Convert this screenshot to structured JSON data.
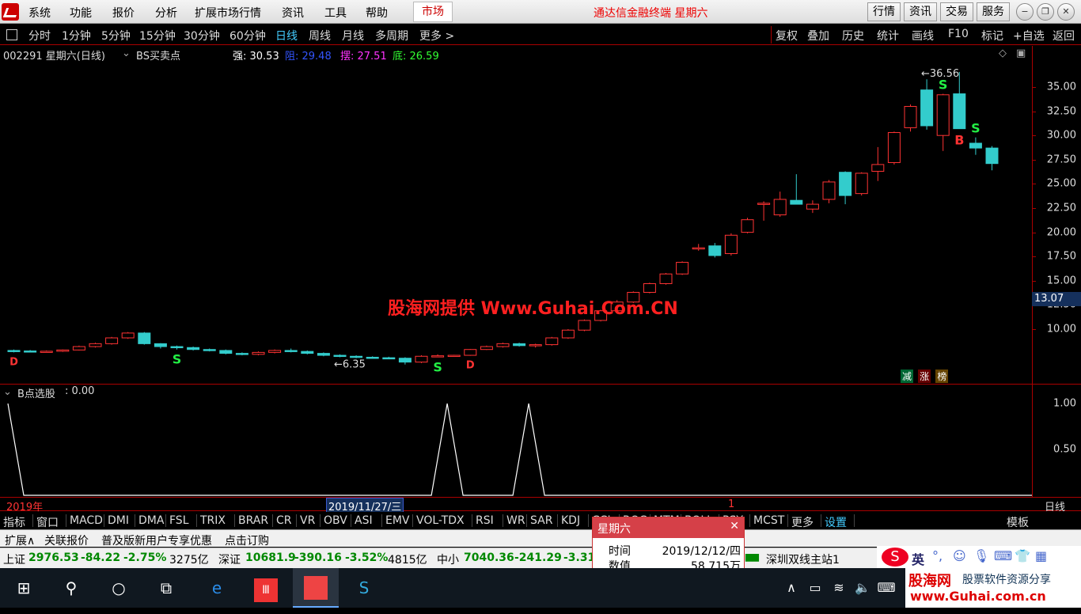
{
  "menu": {
    "items": [
      "系统",
      "功能",
      "报价",
      "分析",
      "扩展市场行情",
      "资讯",
      "工具",
      "帮助"
    ],
    "market_tab": "市场",
    "title": "通达信金融终端 星期六",
    "right_buttons": [
      "行情",
      "资讯",
      "交易",
      "服务"
    ]
  },
  "period_bar": {
    "items": [
      "分时",
      "1分钟",
      "5分钟",
      "15分钟",
      "30分钟",
      "60分钟",
      "日线",
      "周线",
      "月线",
      "多周期",
      "更多 >"
    ],
    "active": "日线",
    "tools": [
      "复权",
      "叠加",
      "历史",
      "统计",
      "画线",
      "F10",
      "标记",
      "+自选",
      "返回"
    ]
  },
  "info": {
    "code_name": "002291 星期六(日线)",
    "indicator": "BS买卖点",
    "strong_label": "强: 30.53",
    "resist_label": "阻: 29.48",
    "swing_label": "摆: 27.51",
    "bottom_label": "底: 26.59"
  },
  "colors": {
    "up": "#ff3333",
    "down": "#33cccc",
    "strong": "#ffffff",
    "resist": "#3355ff",
    "swing": "#ff33ff",
    "bottom": "#33ff33"
  },
  "yaxis": {
    "labels": [
      "35.00",
      "32.50",
      "30.00",
      "27.50",
      "25.00",
      "22.50",
      "20.00",
      "17.50",
      "15.00",
      "12.50",
      "10.00"
    ],
    "current": "13.07"
  },
  "annotations": {
    "high": "36.56",
    "low": "6.35",
    "watermark": "股海网提供 Www.Guhai.Com.CN",
    "badges": [
      "减",
      "涨",
      "榜"
    ]
  },
  "signals": {
    "B": "B",
    "S": "S",
    "D": "D"
  },
  "indicator": {
    "name": "B点选股",
    "value": ": 0.00",
    "axis": [
      "1.00",
      "0.50"
    ]
  },
  "datebar": {
    "year": "2019年",
    "cursor_date": "2019/11/27/三",
    "tick": "1",
    "period": "日线"
  },
  "indicator_tabs": {
    "items": [
      "指标",
      "窗口",
      "MACD",
      "DMI",
      "DMA",
      "FSL",
      "TRIX",
      "BRAR",
      "CR",
      "VR",
      "OBV",
      "ASI",
      "EMV",
      "VOL-TDX",
      "RSI",
      "WR",
      "SAR",
      "KDJ",
      "CCI",
      "ROC",
      "MTM",
      "BOLL",
      "PSY",
      "MCST",
      "更多",
      "设置"
    ],
    "template": "模板"
  },
  "ext_bar": {
    "items": [
      "扩展∧",
      "关联报价",
      "普及版新用户专享优惠",
      "点击订购"
    ]
  },
  "ticker": {
    "sh_label": "上证",
    "sh_val": "2976.53",
    "sh_chg": "-84.22",
    "sh_pct": "-2.75%",
    "sh_amt": "3275亿",
    "sz_label": "深证",
    "sz_val": "10681.9",
    "sz_chg": "-390.16",
    "sz_pct": "-3.52%",
    "sz_amt": "4815亿",
    "zx_label": "中小",
    "zx_val": "7040.36",
    "zx_chg": "-241.29",
    "zx_pct": "-3.31°",
    "server": "深圳双线主站1"
  },
  "popup": {
    "title": "星期六",
    "time_label": "时间",
    "time_val": "2019/12/12/四",
    "value_label": "数值",
    "value_val": "58.715万"
  },
  "ime": {
    "lang": "英"
  },
  "banner": {
    "name": "股海网",
    "slogan": "股票软件资源分享",
    "url": "www.Guhai.com.cn"
  },
  "chart_data": {
    "type": "candlestick",
    "ylim": [
      6.0,
      37.0
    ],
    "ohlc": [
      [
        7.8,
        7.9,
        7.6,
        7.75
      ],
      [
        7.75,
        7.85,
        7.65,
        7.7
      ],
      [
        7.7,
        7.8,
        7.6,
        7.72
      ],
      [
        7.72,
        7.9,
        7.65,
        7.85
      ],
      [
        7.85,
        8.3,
        7.8,
        8.2
      ],
      [
        8.2,
        8.6,
        8.1,
        8.5
      ],
      [
        8.5,
        9.2,
        8.4,
        9.1
      ],
      [
        9.1,
        9.7,
        9.0,
        9.6
      ],
      [
        9.6,
        9.7,
        8.4,
        8.5
      ],
      [
        8.5,
        8.55,
        8.0,
        8.2
      ],
      [
        8.2,
        8.3,
        7.9,
        8.1
      ],
      [
        8.1,
        8.2,
        7.8,
        7.9
      ],
      [
        7.9,
        8.0,
        7.7,
        7.8
      ],
      [
        7.8,
        7.9,
        7.4,
        7.5
      ],
      [
        7.5,
        7.6,
        7.3,
        7.4
      ],
      [
        7.4,
        7.7,
        7.3,
        7.6
      ],
      [
        7.6,
        7.9,
        7.5,
        7.8
      ],
      [
        7.8,
        8.0,
        7.6,
        7.7
      ],
      [
        7.7,
        7.8,
        7.4,
        7.5
      ],
      [
        7.5,
        7.6,
        7.2,
        7.3
      ],
      [
        7.3,
        7.4,
        7.1,
        7.2
      ],
      [
        7.2,
        7.3,
        7.0,
        7.1
      ],
      [
        7.1,
        7.2,
        6.95,
        7.05
      ],
      [
        7.05,
        7.15,
        6.9,
        7.0
      ],
      [
        7.0,
        7.1,
        6.35,
        6.6
      ],
      [
        6.6,
        7.3,
        6.5,
        7.2
      ],
      [
        7.2,
        7.4,
        7.1,
        7.25
      ],
      [
        7.25,
        7.35,
        7.15,
        7.3
      ],
      [
        7.3,
        7.95,
        7.25,
        7.9
      ],
      [
        7.9,
        8.3,
        7.85,
        8.2
      ],
      [
        8.2,
        8.6,
        8.1,
        8.5
      ],
      [
        8.5,
        8.6,
        8.2,
        8.3
      ],
      [
        8.3,
        8.5,
        8.1,
        8.4
      ],
      [
        8.4,
        9.2,
        8.3,
        9.1
      ],
      [
        9.1,
        10.0,
        9.0,
        9.9
      ],
      [
        9.9,
        11.0,
        9.8,
        10.9
      ],
      [
        10.9,
        12.0,
        10.8,
        11.9
      ],
      [
        11.9,
        13.0,
        11.8,
        12.8
      ],
      [
        12.8,
        13.9,
        12.7,
        13.8
      ],
      [
        13.8,
        14.8,
        13.7,
        14.7
      ],
      [
        14.7,
        15.8,
        14.6,
        15.7
      ],
      [
        15.7,
        17.0,
        15.6,
        16.9
      ],
      [
        18.3,
        18.8,
        18.1,
        18.4
      ],
      [
        18.6,
        18.9,
        17.4,
        17.6
      ],
      [
        17.8,
        19.9,
        17.6,
        19.7
      ],
      [
        20.0,
        21.5,
        19.9,
        21.3
      ],
      [
        23.0,
        23.2,
        21.2,
        23.0
      ],
      [
        21.8,
        24.2,
        21.6,
        23.4
      ],
      [
        23.3,
        26.0,
        22.9,
        22.9
      ],
      [
        22.4,
        23.3,
        22.0,
        22.9
      ],
      [
        23.4,
        25.4,
        23.0,
        25.2
      ],
      [
        26.2,
        26.3,
        22.9,
        23.8
      ],
      [
        24.0,
        26.2,
        23.8,
        26.1
      ],
      [
        26.3,
        28.8,
        25.3,
        27.0
      ],
      [
        27.2,
        30.4,
        27.0,
        30.3
      ],
      [
        30.8,
        33.2,
        30.4,
        33.0
      ],
      [
        34.7,
        35.8,
        30.6,
        31.0
      ],
      [
        30.0,
        34.3,
        28.4,
        34.2
      ],
      [
        34.3,
        36.56,
        30.7,
        30.7
      ],
      [
        29.2,
        29.8,
        28.0,
        28.7
      ],
      [
        28.7,
        28.9,
        26.4,
        27.1
      ]
    ],
    "bsignals": [
      24,
      28,
      58
    ],
    "ssignals": [
      10,
      26,
      57,
      59
    ],
    "dsignals": [
      0,
      28
    ],
    "indicator_peaks": [
      26,
      31,
      63
    ],
    "indicator_axis": [
      0,
      1
    ]
  }
}
